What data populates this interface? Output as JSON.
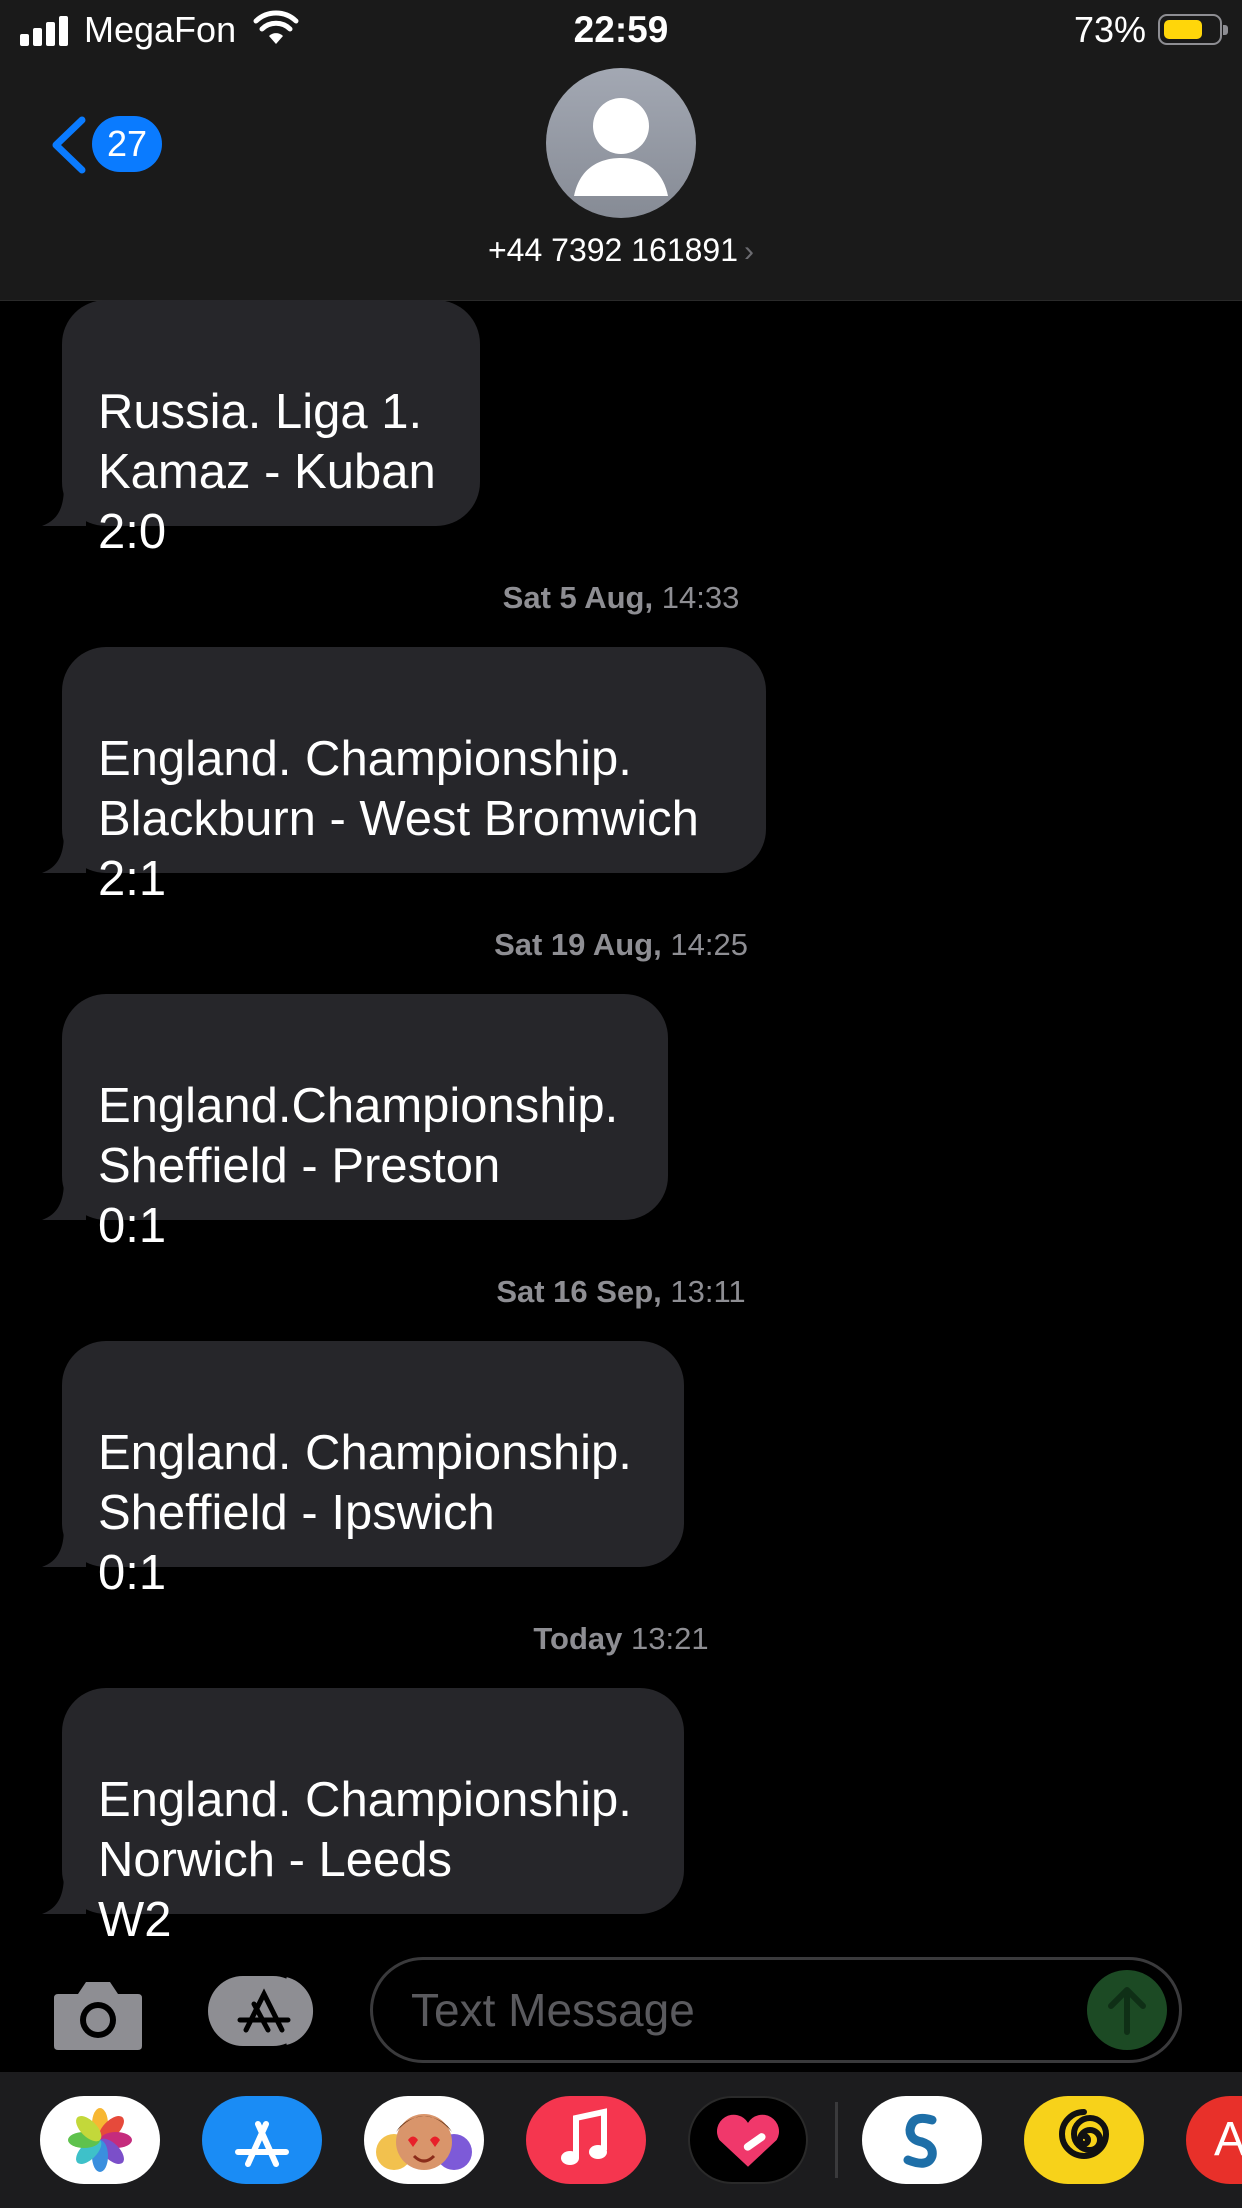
{
  "status_bar": {
    "carrier": "MegaFon",
    "time": "22:59",
    "battery_percent": "73%"
  },
  "header": {
    "back_badge": "27",
    "contact": "+44 7392 161891"
  },
  "messages": [
    {
      "text": "Russia. Liga 1.\nKamaz - Kuban\n2:0"
    },
    {
      "timestamp_day": "Sat 5 Aug,",
      "timestamp_time": "14:33"
    },
    {
      "text": "England. Championship.\nBlackburn - West Bromwich\n2:1"
    },
    {
      "timestamp_day": "Sat 19 Aug,",
      "timestamp_time": "14:25"
    },
    {
      "text": "England.Championship.\nSheffield - Preston\n0:1"
    },
    {
      "timestamp_day": "Sat 16 Sep,",
      "timestamp_time": "13:11"
    },
    {
      "text": "England. Championship.\nSheffield - Ipswich\n0:1"
    },
    {
      "timestamp_day": "Today",
      "timestamp_time": "13:21"
    },
    {
      "text": "England. Championship.\nNorwich - Leeds\nW2"
    }
  ],
  "compose": {
    "placeholder": "Text Message"
  },
  "app_drawer": {
    "apps": [
      "photos-icon",
      "app-store-icon",
      "memoji-icon",
      "music-icon",
      "heart-app-icon",
      "shazam-like-icon",
      "spiral-app-icon",
      "partial-app-icon"
    ],
    "partial_label": "A"
  },
  "colors": {
    "bubble": "#26262a",
    "accent": "#0a7bff",
    "battery": "#ffd60a"
  }
}
